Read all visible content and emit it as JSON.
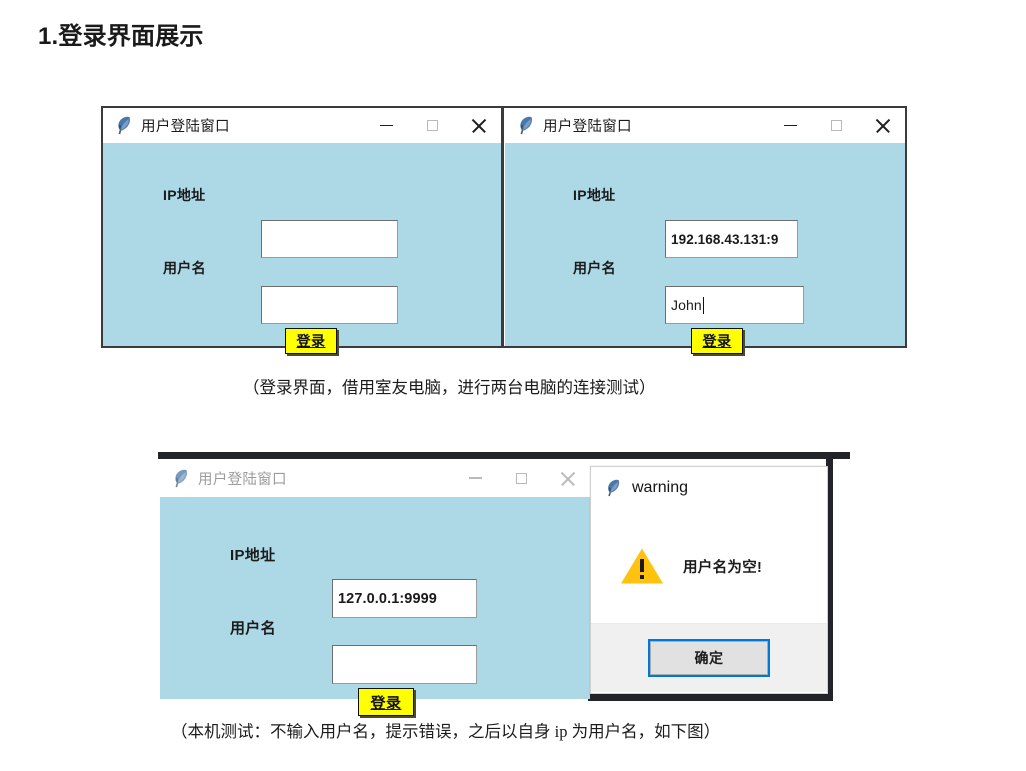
{
  "document": {
    "heading": "1.登录界面展示",
    "caption_top": "（登录界面，借用室友电脑，进行两台电脑的连接测试）",
    "caption_bottom": "（本机测试：不输入用户名，提示错误，之后以自身 ip 为用户名，如下图）"
  },
  "colors": {
    "window_body": "#add8e6",
    "titlebar": "#ffffff",
    "button_accent": "#ffff00",
    "warning_triangle": "#ffc20e",
    "focus_ring": "#0078d7",
    "dialog_footer": "#f0f0f0"
  },
  "window_controls": {
    "minimize": "minimize-icon",
    "maximize": "maximize-icon",
    "close": "close-icon"
  },
  "windows": [
    {
      "id": "login-window-empty",
      "title": "用户登陆窗口",
      "icon": "feather-icon",
      "active": true,
      "fields": [
        {
          "label": "IP地址",
          "value": "",
          "placeholder": ""
        },
        {
          "label": "用户名",
          "value": "",
          "placeholder": ""
        }
      ],
      "submit_label": "登录"
    },
    {
      "id": "login-window-filled",
      "title": "用户登陆窗口",
      "icon": "feather-icon",
      "active": true,
      "fields": [
        {
          "label": "IP地址",
          "value": "192.168.43.131:9",
          "placeholder": ""
        },
        {
          "label": "用户名",
          "value": "John",
          "placeholder": "",
          "caret": true
        }
      ],
      "submit_label": "登录"
    },
    {
      "id": "login-window-local",
      "title": "用户登陆窗口",
      "icon": "feather-icon",
      "active": false,
      "fields": [
        {
          "label": "IP地址",
          "value": "127.0.0.1:9999",
          "placeholder": ""
        },
        {
          "label": "用户名",
          "value": "",
          "placeholder": ""
        }
      ],
      "submit_label": "登录"
    }
  ],
  "dialog": {
    "id": "warning-dialog",
    "title": "warning",
    "icon": "feather-icon",
    "alert_icon": "warning-triangle-icon",
    "message": "用户名为空!",
    "ok_label": "确定",
    "close": "close-icon"
  }
}
